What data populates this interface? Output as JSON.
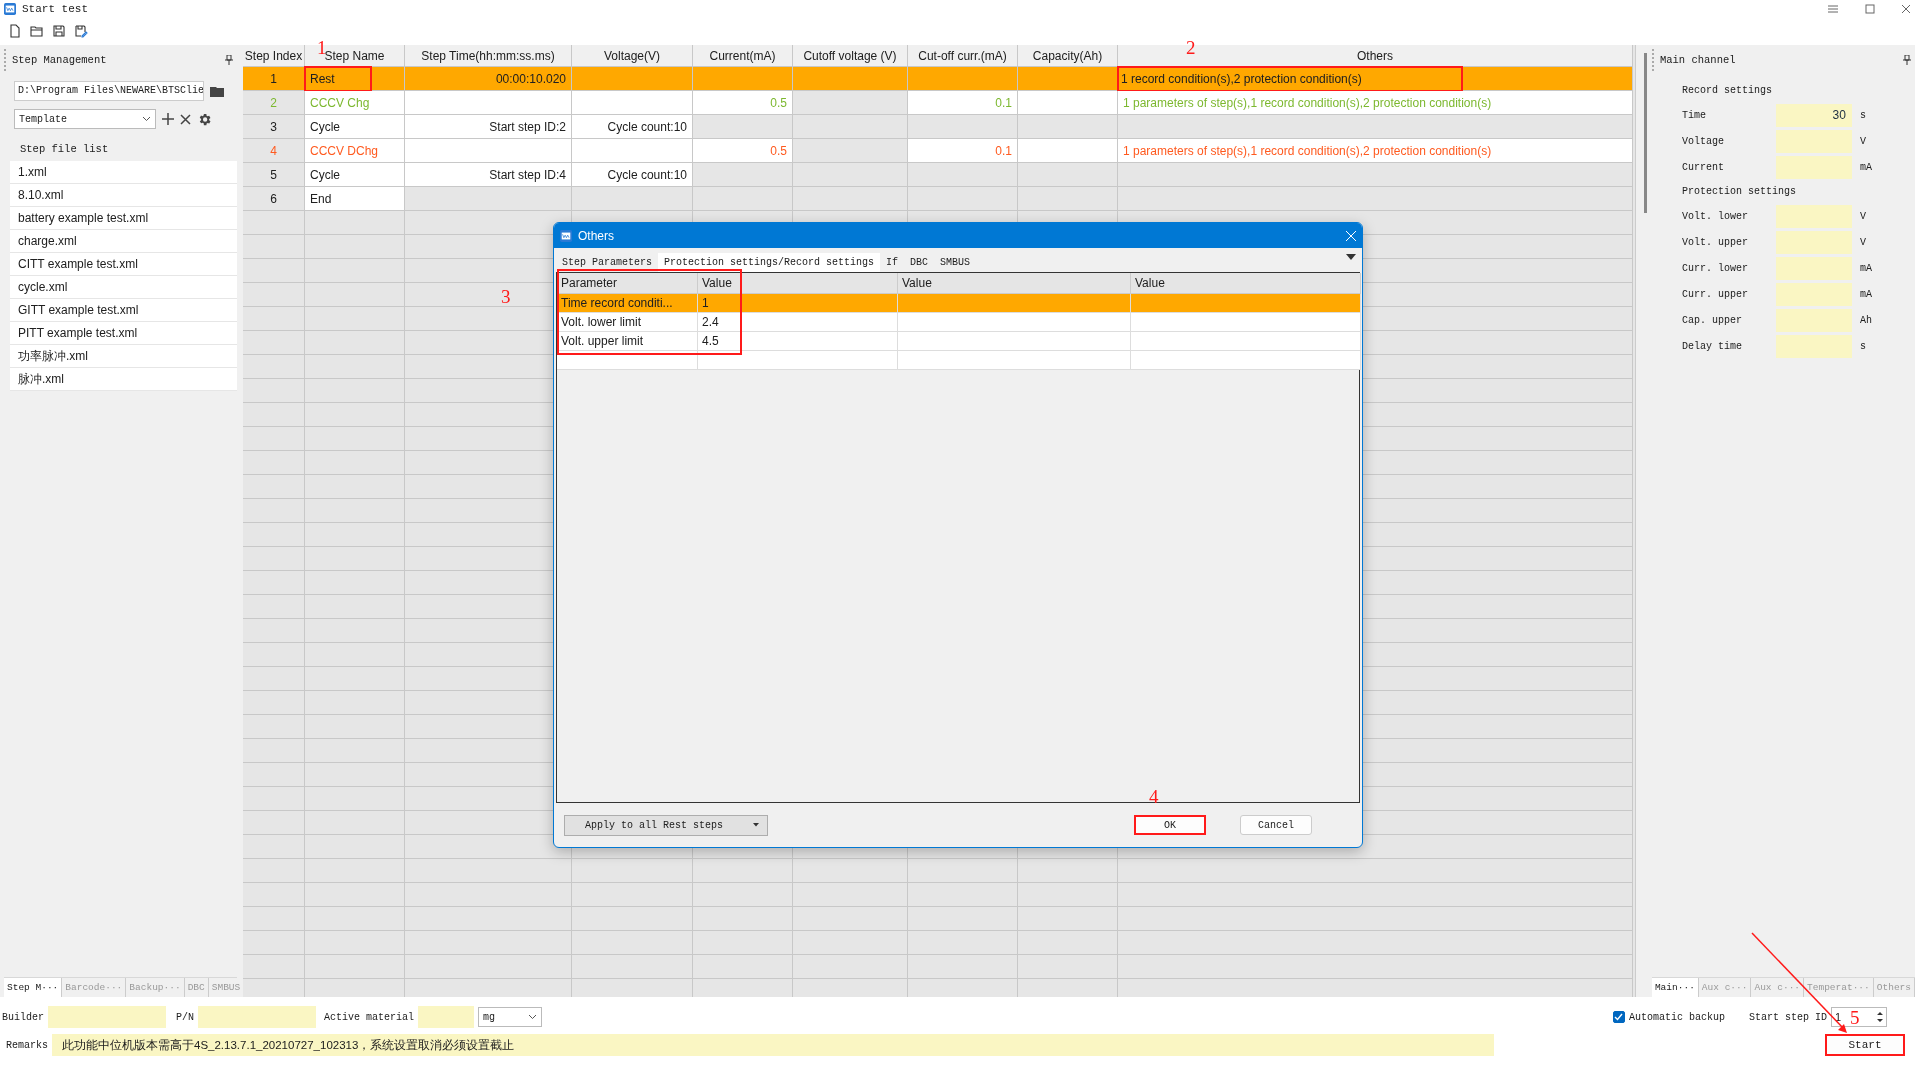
{
  "window": {
    "title": "Start test"
  },
  "toolbar": {
    "items": [
      {
        "kind": "new"
      },
      {
        "kind": "open"
      },
      {
        "kind": "save"
      },
      {
        "kind": "save_as"
      }
    ]
  },
  "step_management": {
    "title": "Step Management",
    "path": "D:\\Program Files\\NEWARE\\BTSClie",
    "template": "Template",
    "file_list_title": "Step file list",
    "files": [
      "1.xml",
      "8.10.xml",
      "battery example test.xml",
      "charge.xml",
      "CITT example test.xml",
      "cycle.xml",
      "GITT example test.xml",
      "PITT example test.xml",
      "功率脉冲.xml",
      "脉冲.xml"
    ],
    "tabs": [
      {
        "label": "Step M···",
        "selected": true
      },
      {
        "label": "Barcode···",
        "selected": false
      },
      {
        "label": "Backup···",
        "selected": false
      },
      {
        "label": "DBC",
        "selected": false
      },
      {
        "label": "SMBUS",
        "selected": false
      }
    ]
  },
  "table": {
    "columns": [
      "Step Index",
      "Step Name",
      "Step Time(hh:mm:ss.ms)",
      "Voltage(V)",
      "Current(mA)",
      "Cutoff voltage (V)",
      "Cut-off curr.(mA)",
      "Capacity(Ah)",
      "Others"
    ],
    "rows": [
      {
        "kind": "step",
        "selected": true,
        "cells": [
          "1",
          "Rest",
          "00:00:10.020",
          "",
          "",
          "",
          "",
          "",
          "1 record condition(s),2 protection condition(s)"
        ],
        "name_mark": "1",
        "others_mark": "2"
      },
      {
        "kind": "step",
        "selected": false,
        "color": "#7cb82f",
        "cells": [
          "2",
          "CCCV Chg",
          "",
          "",
          "0.5",
          "",
          "0.1",
          "",
          "1 parameters of step(s),1 record condition(s),2 protection condition(s)"
        ]
      },
      {
        "kind": "cycle",
        "selected": false,
        "cells": [
          "3",
          "Cycle",
          "Start step ID:2",
          "Cycle count:10",
          "",
          "",
          "",
          "",
          ""
        ]
      },
      {
        "kind": "step",
        "selected": false,
        "color": "#ff5a1f",
        "cells": [
          "4",
          "CCCV DChg",
          "",
          "",
          "0.5",
          "",
          "0.1",
          "",
          "1 parameters of step(s),1 record condition(s),2 protection condition(s)"
        ]
      },
      {
        "kind": "cycle",
        "selected": false,
        "cells": [
          "5",
          "Cycle",
          "Start step ID:4",
          "Cycle count:10",
          "",
          "",
          "",
          "",
          ""
        ]
      },
      {
        "kind": "end",
        "selected": false,
        "cells": [
          "6",
          "End",
          "",
          "",
          "",
          "",
          "",
          "",
          ""
        ]
      }
    ]
  },
  "dialog": {
    "title": "Others",
    "tabs": [
      {
        "label": "Step Parameters",
        "selected": false
      },
      {
        "label": "Protection settings/Record settings",
        "selected": true
      },
      {
        "label": "If",
        "selected": false
      },
      {
        "label": "DBC",
        "selected": false
      },
      {
        "label": "SMBUS",
        "selected": false
      }
    ],
    "columns": [
      "Parameter",
      "Value",
      "Value",
      "Value"
    ],
    "rows": [
      {
        "selected": true,
        "cells": [
          "Time record conditi...",
          "1",
          "",
          ""
        ]
      },
      {
        "selected": false,
        "cells": [
          "Volt. lower limit",
          "2.4",
          "",
          ""
        ]
      },
      {
        "selected": false,
        "cells": [
          "Volt. upper limit",
          "4.5",
          "",
          ""
        ]
      }
    ],
    "table_mark": "3",
    "apply_button": "Apply to all Rest steps",
    "ok_button": {
      "label": "OK",
      "mark": "4"
    },
    "cancel_button": "Cancel"
  },
  "main_channel": {
    "title": "Main channel",
    "items": [
      {
        "kind": "heading",
        "label": "Record settings"
      },
      {
        "kind": "field",
        "label": "Time",
        "value": "30",
        "unit": "s"
      },
      {
        "kind": "field",
        "label": "Voltage",
        "unit": "V"
      },
      {
        "kind": "field",
        "label": "Current",
        "unit": "mA"
      },
      {
        "kind": "heading",
        "label": "Protection settings"
      },
      {
        "kind": "field",
        "label": "Volt. lower",
        "unit": "V"
      },
      {
        "kind": "field",
        "label": "Volt. upper",
        "unit": "V"
      },
      {
        "kind": "field",
        "label": "Curr. lower",
        "unit": "mA"
      },
      {
        "kind": "field",
        "label": "Curr. upper",
        "unit": "mA"
      },
      {
        "kind": "field",
        "label": "Cap. upper",
        "unit": "Ah"
      },
      {
        "kind": "field",
        "label": "Delay time",
        "unit": "s"
      }
    ],
    "tabs": [
      {
        "label": "Main···",
        "selected": true
      },
      {
        "label": "Aux c···",
        "selected": false
      },
      {
        "label": "Aux c···",
        "selected": false
      },
      {
        "label": "Temperat···",
        "selected": false
      },
      {
        "label": "Others",
        "selected": false
      }
    ]
  },
  "form": {
    "builder_label": "Builder",
    "pn_label": "P/N",
    "active_material_label": "Active material",
    "unit": "mg",
    "automatic_backup": {
      "label": "Automatic backup",
      "checked": true
    },
    "start_step_label": "Start step ID",
    "start_step": "1",
    "start_button": {
      "label": "Start",
      "mark": "5"
    },
    "remarks_label": "Remarks",
    "remarks": "此功能中位机版本需高于4S_2.13.7.1_20210727_102313，系统设置取消必须设置截止"
  }
}
